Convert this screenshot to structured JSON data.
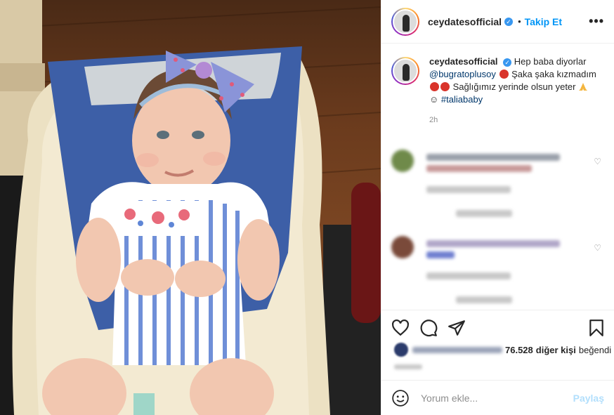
{
  "post": {
    "username": "ceydatesofficial",
    "verified_icon": "✓",
    "dot": "•",
    "follow_label": "Takip Et",
    "more_label": "•••"
  },
  "caption": {
    "username": "ceydatesofficial",
    "text_1": "Hep baba diyorlar",
    "mention": "@bugratoplusoy",
    "text_2": "Şaka şaka kızmadım",
    "text_3": "Sağlığımız yerinde olsun yeter",
    "hashtag": "#taliababy",
    "time": "2h"
  },
  "actions": {
    "like_icon": "heart-icon",
    "comment_icon": "comment-icon",
    "share_icon": "share-icon",
    "save_icon": "bookmark-icon"
  },
  "likes": {
    "count": "76.528",
    "suffix_1": "diğer kişi",
    "suffix_2": "beğendi"
  },
  "comment_box": {
    "placeholder": "Yorum ekle...",
    "post_label": "Paylaş"
  },
  "colors": {
    "accent": "#0095f6",
    "verified": "#3897f0",
    "post_disabled": "#b2dffc"
  }
}
